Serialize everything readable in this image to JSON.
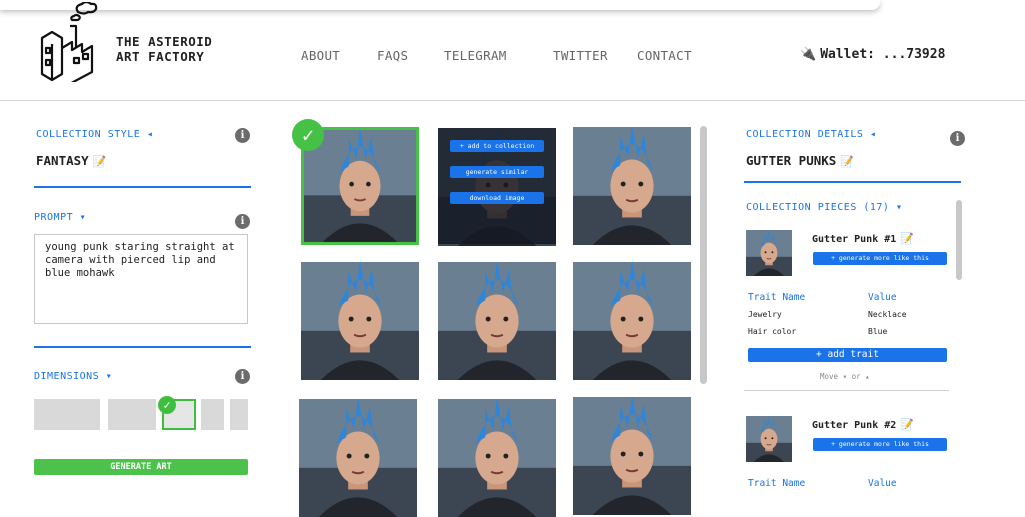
{
  "brand": {
    "line1": "THE ASTEROID",
    "line2": "ART FACTORY",
    "logo_icon": "factory-icon"
  },
  "nav": [
    "ABOUT",
    "FAQS",
    "TELEGRAM",
    "TWITTER",
    "CONTACT"
  ],
  "wallet": {
    "icon": "plug-icon",
    "label": "Wallet: ...73928"
  },
  "left": {
    "collection_style_title": "COLLECTION STYLE ◂",
    "collection_style_value": "FANTASY",
    "prompt_title": "PROMPT ▾",
    "prompt_text": "young punk staring straight at camera with pierced lip and blue mohawk",
    "dimensions_title": "DIMENSIONS ▾",
    "generate_label": "GENERATE ART"
  },
  "grid_overlay": {
    "add_label": "+ add to collection",
    "similar_label": "generate similar",
    "download_label": "download image"
  },
  "right": {
    "details_title": "COLLECTION DETAILS ◂",
    "collection_name": "GUTTER PUNKS",
    "pieces_title": "COLLECTION PIECES (17) ▾",
    "pieces": [
      {
        "name": "Gutter Punk #1",
        "more_label": "+ generate more like this"
      },
      {
        "name": "Gutter Punk #2",
        "more_label": "+ generate more like this"
      }
    ],
    "trait_headers": {
      "name": "Trait Name",
      "value": "Value"
    },
    "traits": [
      {
        "name": "Jewelry",
        "value": "Necklace"
      },
      {
        "name": "Hair color",
        "value": "Blue"
      }
    ],
    "add_trait_label": "+ add trait",
    "move_label": "Move ▾ or ▴"
  },
  "colors": {
    "accent": "#1a73e8",
    "success": "#45c145",
    "mohawk": "#2f86d9"
  }
}
